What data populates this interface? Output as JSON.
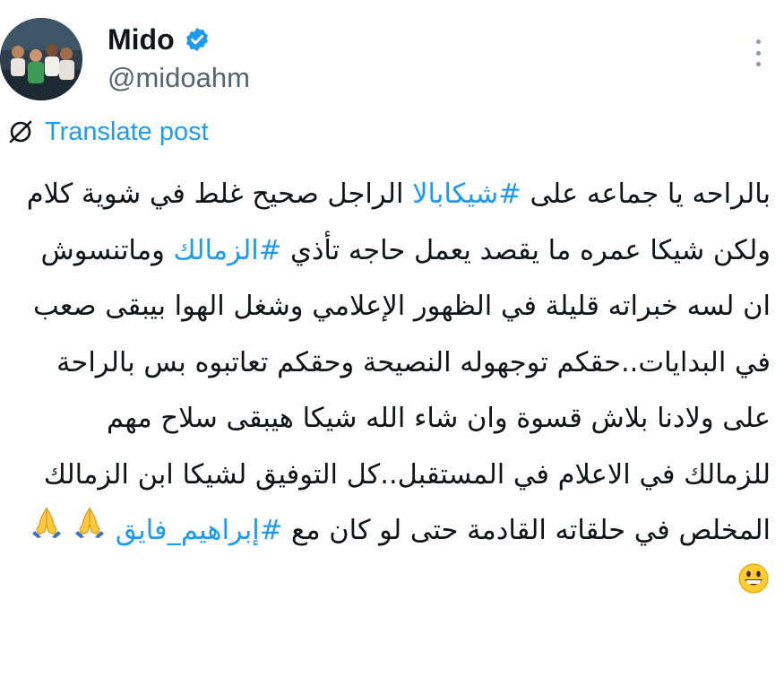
{
  "author": {
    "display_name": "Mido",
    "handle": "@midoahm",
    "verified": true
  },
  "translate": {
    "label": "Translate post"
  },
  "tweet": {
    "segments": [
      {
        "text": "بالراحه يا جماعه على ",
        "type": "text"
      },
      {
        "text": "#شيكابالا",
        "type": "hashtag"
      },
      {
        "text": " الراجل صحيح غلط في شوية كلام ولكن شيكا عمره ما يقصد يعمل حاجه تأذي ",
        "type": "text"
      },
      {
        "text": "#الزمالك",
        "type": "hashtag"
      },
      {
        "text": " وماتنسوش ان لسه خبراته قليلة في الظهور الإعلامي وشغل الهوا بيبقى صعب في البدايات..حقكم توجهوله النصيحة وحقكم تعاتبوه بس بالراحة على ولادنا بلاش قسوة وان شاء الله شيكا هيبقى سلاح مهم للزمالك في الاعلام في المستقبل..كل التوفيق لشيكا ابن الزمالك المخلص في حلقاته القادمة حتى لو كان مع ",
        "type": "text"
      },
      {
        "text": "#إبراهيم_فايق",
        "type": "hashtag"
      }
    ],
    "emojis": [
      "pray-emoji",
      "pray-emoji",
      "grinning-emoji"
    ]
  },
  "colors": {
    "link": "#1d9bf0",
    "text": "#0f1419",
    "secondary": "#536471",
    "verified": "#1d9bf0"
  },
  "icons": [
    "verified-badge-icon",
    "more-options-icon",
    "translate-icon"
  ]
}
